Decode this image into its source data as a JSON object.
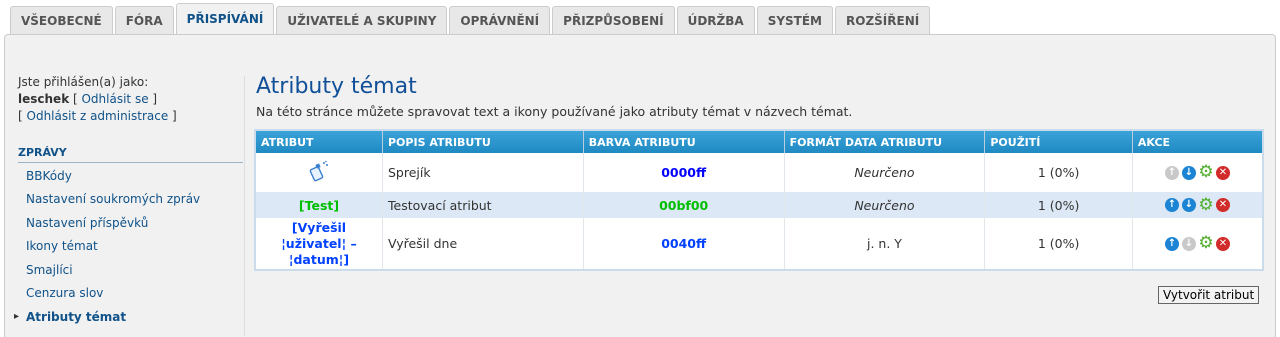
{
  "tabs": [
    "VŠEOBECNÉ",
    "FÓRA",
    "PŘISPÍVÁNÍ",
    "UŽIVATELÉ A SKUPINY",
    "OPRÁVNĚNÍ",
    "PŘIZPŮSOBENÍ",
    "ÚDRŽBA",
    "SYSTÉM",
    "ROZŠÍŘENÍ"
  ],
  "login": {
    "logged_as": "Jste přihlášen(a) jako:",
    "username": "leschek",
    "logout": "Odhlásit se",
    "logout_admin": "Odhlásit z administrace"
  },
  "sidebar": {
    "section": "ZPRÁVY",
    "items": [
      "BBKódy",
      "Nastavení soukromých zpráv",
      "Nastavení příspěvků",
      "Ikony témat",
      "Smajlíci",
      "Cenzura slov",
      "Atributy témat"
    ]
  },
  "main": {
    "title": "Atributy témat",
    "description": "Na této stránce můžete spravovat text a ikony používané jako atributy témat v názvech témat."
  },
  "table": {
    "headers": [
      "ATRIBUT",
      "POPIS ATRIBUTU",
      "BARVA ATRIBUTU",
      "FORMÁT DATA ATRIBUTU",
      "POUŽITÍ",
      "AKCE"
    ],
    "rows": [
      {
        "attribute": "",
        "icon": "spray-icon",
        "description": "Sprejík",
        "color": "0000ff",
        "date_format": "Neurčeno",
        "usage": "1 (0%)"
      },
      {
        "attribute": "[Test]",
        "description": "Testovací atribut",
        "color": "00bf00",
        "date_format": "Neurčeno",
        "usage": "1 (0%)"
      },
      {
        "attribute_lines": [
          "[Vyřešil",
          "¦uživatel¦ –",
          "¦datum¦]"
        ],
        "description": "Vyřešil dne",
        "color": "0040ff",
        "date_format": "j. n. Y",
        "usage": "1 (0%)"
      }
    ]
  },
  "create_button": "Vytvořit atribut",
  "colors": {
    "link": "#105289",
    "header_bg": "#1f89c3",
    "row_alt": "#dce8f5"
  }
}
